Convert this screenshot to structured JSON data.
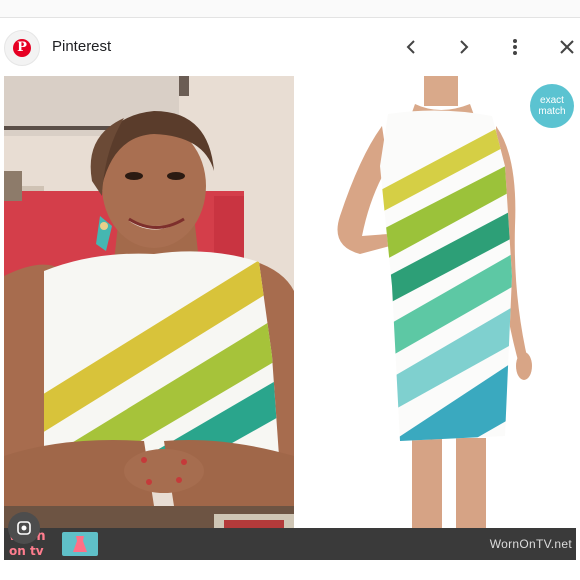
{
  "header": {
    "title": "Pinterest",
    "logo_letter": "P",
    "icons": [
      "pinterest-logo-icon",
      "chevron-left-icon",
      "chevron-right-icon",
      "more-vert-icon",
      "close-icon"
    ]
  },
  "image": {
    "badge_line1": "exact",
    "badge_line2": "match",
    "footer_logo_top": "worn",
    "footer_logo_bottom": "on tv",
    "footer_url": "WornOnTV.net"
  },
  "colors": {
    "pinterest_red": "#e60023",
    "badge_teal": "#5bc3d1",
    "footer_bar": "#3a3a3a"
  }
}
